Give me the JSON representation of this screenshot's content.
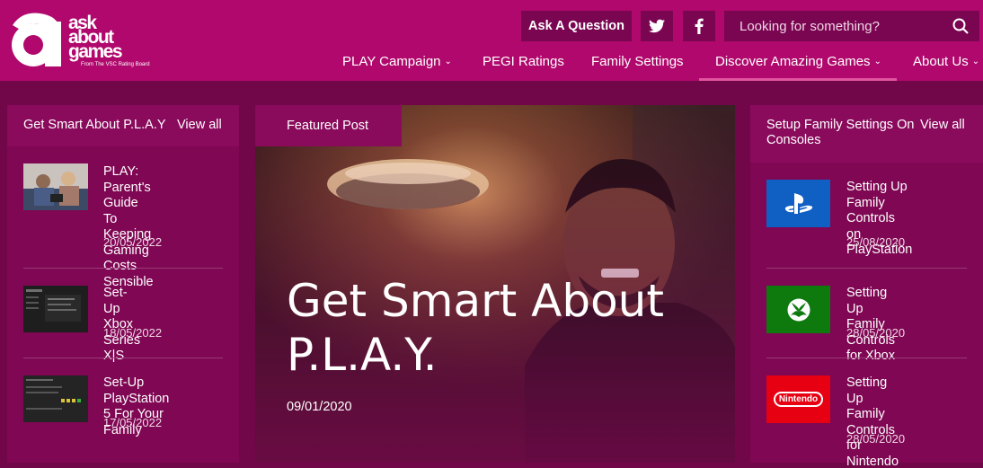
{
  "brand": {
    "logo_words": [
      "ask",
      "about",
      "games"
    ],
    "logo_sub": "From The VSC Rating Board"
  },
  "header": {
    "ask_label": "Ask A Question",
    "search_placeholder": "Looking for something?"
  },
  "nav": {
    "items": [
      {
        "label": "PLAY Campaign",
        "has_dropdown": true
      },
      {
        "label": "PEGI Ratings",
        "has_dropdown": false
      },
      {
        "label": "Family Settings",
        "has_dropdown": false
      },
      {
        "label": "Discover Amazing Games",
        "has_dropdown": true
      },
      {
        "label": "About Us",
        "has_dropdown": true
      }
    ]
  },
  "left": {
    "heading": "Get Smart About P.L.A.Y",
    "view_all": "View all",
    "items": [
      {
        "title_lines": [
          "PLAY: Parent's",
          "Guide To Keeping",
          "Gaming Costs",
          "Sensible"
        ],
        "date": "20/05/2022"
      },
      {
        "title_lines": [
          "Set-Up Xbox Series",
          "X|S"
        ],
        "date": "18/05/2022"
      },
      {
        "title_lines": [
          "Set-Up PlayStation",
          "5 For Your Family"
        ],
        "date": "17/05/2022"
      }
    ]
  },
  "featured": {
    "tag": "Featured Post",
    "title_lines": [
      "Get Smart About",
      "P.L.A.Y."
    ],
    "date": "09/01/2020"
  },
  "right": {
    "heading_lines": [
      "Setup Family Settings On",
      "Consoles"
    ],
    "view_all": "View all",
    "items": [
      {
        "title_lines": [
          "Setting Up Family",
          "Controls on",
          "PlayStation"
        ],
        "date": "25/08/2020",
        "logo": "playstation-logo"
      },
      {
        "title_lines": [
          "Setting Up Family",
          "Controls for Xbox"
        ],
        "date": "28/05/2020",
        "logo": "xbox-logo"
      },
      {
        "title_lines": [
          "Setting Up Family",
          "Controls for",
          "Nintendo Switch"
        ],
        "date": "28/05/2020",
        "logo": "nintendo-logo",
        "logo_text": "Nintendo"
      }
    ]
  },
  "colors": {
    "header": "#b0086c",
    "background": "#710649",
    "panel": "#7f0753",
    "playstation": "#1060c4",
    "xbox": "#0e7a0d",
    "nintendo": "#e60012"
  }
}
